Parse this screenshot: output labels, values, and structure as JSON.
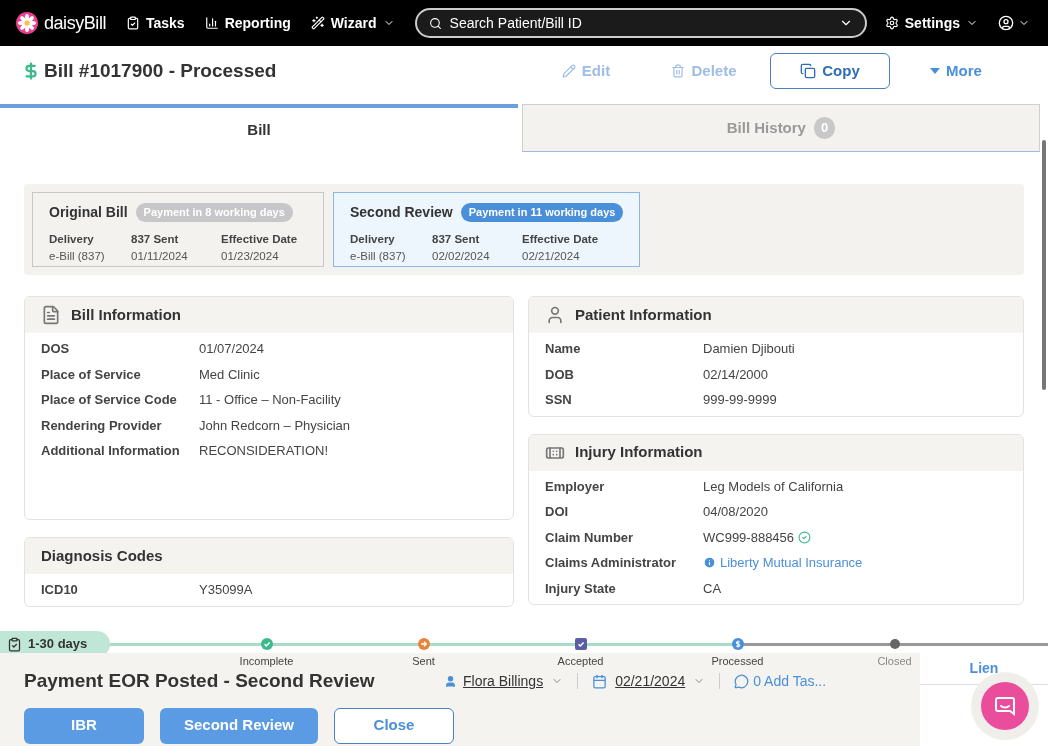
{
  "nav": {
    "logo": "daisyBill",
    "items": [
      {
        "label": "Tasks",
        "kind": "tasks"
      },
      {
        "label": "Reporting",
        "kind": "reporting"
      },
      {
        "label": "Wizard",
        "kind": "wizard"
      }
    ],
    "search": {
      "placeholder": "Search Patient/Bill ID"
    },
    "settings": "Settings"
  },
  "header": {
    "title": "Bill #1017900 - Processed",
    "actions": [
      {
        "label": "Edit",
        "kind": "edit",
        "disabled": true
      },
      {
        "label": "Delete",
        "kind": "delete",
        "disabled": true
      },
      {
        "label": "Copy",
        "kind": "copy",
        "disabled": false
      },
      {
        "label": "More",
        "kind": "more",
        "disabled": false
      }
    ]
  },
  "tabs": [
    {
      "label": "Bill",
      "selected": true
    },
    {
      "label": "Bill History",
      "selected": false,
      "count": "0"
    }
  ],
  "reviews": [
    {
      "title": "Original Bill",
      "badge": "Payment in 8 working days",
      "selected": false,
      "fields": [
        {
          "label": "Delivery",
          "value": "e-Bill (837)"
        },
        {
          "label": "837 Sent",
          "value": "01/11/2024"
        },
        {
          "label": "Effective Date",
          "value": "01/23/2024"
        }
      ]
    },
    {
      "title": "Second Review",
      "badge": "Payment in 11 working days",
      "selected": true,
      "fields": [
        {
          "label": "Delivery",
          "value": "e-Bill (837)"
        },
        {
          "label": "837 Sent",
          "value": "02/02/2024"
        },
        {
          "label": "Effective Date",
          "value": "02/21/2024"
        }
      ]
    }
  ],
  "bill_information": {
    "title": "Bill Information",
    "rows": [
      {
        "label": "DOS",
        "value": "01/07/2024"
      },
      {
        "label": "Place of Service",
        "value": "Med Clinic"
      },
      {
        "label": "Place of Service Code",
        "value": "11 - Office – Non-Facility"
      },
      {
        "label": "Rendering Provider",
        "value": "John Redcorn – Physician"
      },
      {
        "label": "Additional Information",
        "value": "RECONSIDERATION!"
      }
    ]
  },
  "diagnosis_codes": {
    "title": "Diagnosis Codes",
    "rows": [
      {
        "label": "ICD10",
        "value": "Y35099A"
      }
    ]
  },
  "patient_information": {
    "title": "Patient Information",
    "rows": [
      {
        "label": "Name",
        "value": "Damien Djibouti"
      },
      {
        "label": "DOB",
        "value": "02/14/2000"
      },
      {
        "label": "SSN",
        "value": "999-99-9999"
      }
    ]
  },
  "injury_information": {
    "title": "Injury Information",
    "rows": [
      {
        "label": "Employer",
        "value": "Leg Models of California",
        "kind": "text"
      },
      {
        "label": "DOI",
        "value": "04/08/2020",
        "kind": "text"
      },
      {
        "label": "Claim Number",
        "value": "WC999-888456",
        "kind": "verified"
      },
      {
        "label": "Claims Administrator",
        "value": "Liberty Mutual Insurance",
        "kind": "link"
      },
      {
        "label": "Injury State",
        "value": "CA",
        "kind": "text"
      }
    ]
  },
  "workflow": {
    "age": "1-30 days",
    "steps": [
      {
        "label": "Incomplete",
        "kind": "check",
        "color": "#3db88b",
        "done": true
      },
      {
        "label": "Sent",
        "kind": "arrow",
        "color": "#e8843c",
        "done": true
      },
      {
        "label": "Accepted",
        "kind": "box",
        "color": "#5b5ea6",
        "done": true
      },
      {
        "label": "Processed",
        "kind": "dollar",
        "color": "#4a8fd9",
        "done": true
      },
      {
        "label": "Closed",
        "kind": "dot",
        "color": "#666666",
        "done": false
      }
    ],
    "title": "Payment EOR Posted - Second Review",
    "assignee": "Flora Billings",
    "date": "02/21/2024",
    "tasks": "0 Add Tas...",
    "buttons": [
      {
        "label": "IBR",
        "kind": "primary"
      },
      {
        "label": "Second Review",
        "kind": "primary"
      },
      {
        "label": "Close",
        "kind": "outline"
      }
    ],
    "side_tab": "Lien"
  }
}
